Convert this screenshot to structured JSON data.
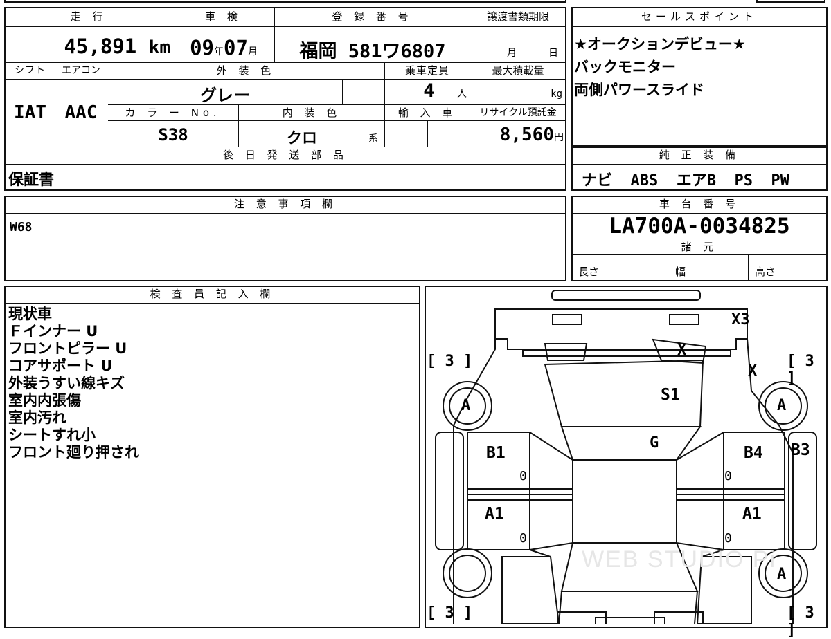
{
  "mileage": {
    "label": "走 行",
    "value": "45,891",
    "unit": "km"
  },
  "inspection": {
    "label": "車 検",
    "year": "09",
    "year_unit": "年",
    "month": "07",
    "month_unit": "月"
  },
  "registration": {
    "label": "登 録 番 号",
    "value": "福岡 581ワ6807"
  },
  "transfer_deadline": {
    "label": "譲渡書類期限",
    "month_unit": "月",
    "day_unit": "日"
  },
  "sales_points": {
    "label": "セールスポイント",
    "lines": [
      "★オークションデビュー★",
      "バックモニター",
      "両側パワースライド"
    ]
  },
  "shift": {
    "label": "シフト",
    "value": "IAT"
  },
  "aircon": {
    "label": "エアコン",
    "value": "AAC"
  },
  "exterior_color": {
    "label": "外 装 色",
    "value": "グレー"
  },
  "capacity": {
    "label": "乗車定員",
    "value": "4",
    "unit": "人"
  },
  "max_load": {
    "label": "最大積載量",
    "unit": "kg"
  },
  "color_no": {
    "label": "カ ラ ー No.",
    "value": "S38"
  },
  "interior_color": {
    "label": "内 装 色",
    "value": "クロ",
    "suffix": "系"
  },
  "import": {
    "label": "輸 入 車"
  },
  "recycle_fee": {
    "label": "リサイクル預託金",
    "value": "8,560",
    "unit": "円"
  },
  "later_parts": {
    "label": "後 日 発 送 部 品",
    "value": "保証書"
  },
  "equipment": {
    "label": "純 正 装 備",
    "value": "ナビ  ABS  エアB  PS  PW"
  },
  "notes": {
    "label": "注 意 事 項 欄",
    "value": "W68"
  },
  "chassis_no": {
    "label": "車 台 番 号",
    "value": "LA700A-0034825"
  },
  "specs": {
    "label": "諸 元",
    "length": "長さ",
    "width": "幅",
    "height": "高さ"
  },
  "inspector": {
    "label": "検 査 員 記 入 欄",
    "lines": [
      "現状車",
      "Ｆインナー U",
      "フロントピラー U",
      "コアサポート U",
      "外装うすい線キズ",
      "室内内張傷",
      "室内汚れ",
      "シートすれ小",
      "フロント廻り押され"
    ]
  },
  "diagram": {
    "marks": {
      "rear": "X3",
      "rear_glass": "X",
      "right_rear_panel": "X",
      "roof": "S1",
      "front_glass": "G",
      "left_rear_door": "B1",
      "right_rear_door": "B4",
      "right_side": "B3",
      "left_front_door": "A1",
      "right_front_door": "A1",
      "left_rear_tire": "A",
      "right_rear_tire": "A",
      "right_front_tire": "A"
    },
    "tread": {
      "left_rear": "3",
      "right_rear": "3",
      "left_front": "3",
      "right_front": "3"
    },
    "zeros": "0",
    "watermark": "WEB STUDIO Pi"
  }
}
